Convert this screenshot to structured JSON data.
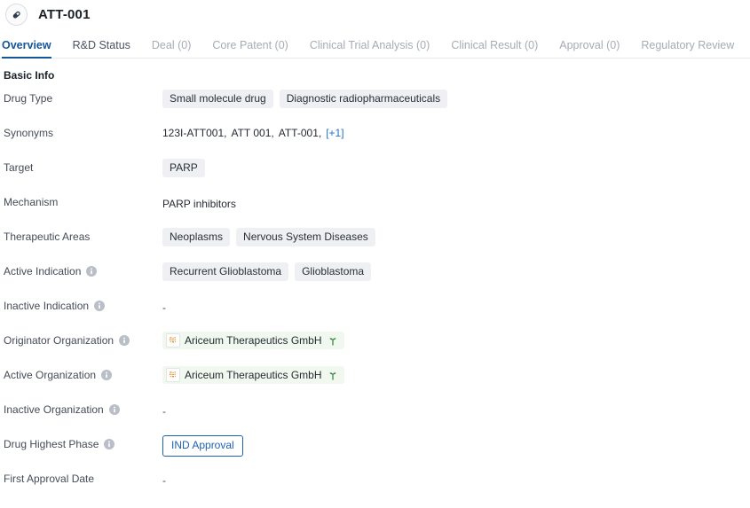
{
  "header": {
    "icon": "pill-capsule-icon",
    "title": "ATT-001"
  },
  "tabs": [
    {
      "label": "Overview",
      "active": true,
      "muted": false
    },
    {
      "label": "R&D Status",
      "active": false,
      "muted": false
    },
    {
      "label": "Deal (0)",
      "active": false,
      "muted": true
    },
    {
      "label": "Core Patent (0)",
      "active": false,
      "muted": true
    },
    {
      "label": "Clinical Trial Analysis (0)",
      "active": false,
      "muted": true
    },
    {
      "label": "Clinical Result (0)",
      "active": false,
      "muted": true
    },
    {
      "label": "Approval (0)",
      "active": false,
      "muted": true
    },
    {
      "label": "Regulatory Review",
      "active": false,
      "muted": true
    }
  ],
  "section": {
    "title": "Basic Info"
  },
  "colors": {
    "accent": "#15559a",
    "link": "#2572c7",
    "chip_bg": "#eff0f3",
    "org_bg": "#f1f8f0",
    "phase_border": "#1e61ad",
    "muted_text": "#a6abb5"
  },
  "rows": {
    "drug_type": {
      "label": "Drug Type",
      "has_info": false,
      "chips": [
        "Small molecule drug",
        "Diagnostic radiopharmaceuticals"
      ]
    },
    "synonyms": {
      "label": "Synonyms",
      "has_info": false,
      "values": [
        "123I-ATT001,",
        "ATT 001,",
        "ATT-001,"
      ],
      "more": "[+1]"
    },
    "target": {
      "label": "Target",
      "has_info": false,
      "chips": [
        "PARP"
      ]
    },
    "mechanism": {
      "label": "Mechanism",
      "has_info": false,
      "text": "PARP inhibitors"
    },
    "therapeutic_areas": {
      "label": "Therapeutic Areas",
      "has_info": false,
      "chips": [
        "Neoplasms",
        "Nervous System Diseases"
      ]
    },
    "active_indication": {
      "label": "Active Indication",
      "has_info": true,
      "chips": [
        "Recurrent Glioblastoma",
        "Glioblastoma"
      ]
    },
    "inactive_indication": {
      "label": "Inactive Indication",
      "has_info": true,
      "text": "-"
    },
    "originator_organization": {
      "label": "Originator Organization",
      "has_info": true,
      "orgs": [
        "Ariceum Therapeutics GmbH"
      ]
    },
    "active_organization": {
      "label": "Active Organization",
      "has_info": true,
      "orgs": [
        "Ariceum Therapeutics GmbH"
      ]
    },
    "inactive_organization": {
      "label": "Inactive Organization",
      "has_info": true,
      "text": "-"
    },
    "drug_highest_phase": {
      "label": "Drug Highest Phase",
      "has_info": true,
      "button": "IND Approval"
    },
    "first_approval_date": {
      "label": "First Approval Date",
      "has_info": false,
      "text": "-"
    }
  },
  "icons": {
    "info": "info-circle-icon",
    "org_logo": "company-logo-icon",
    "sprout": "sprout-icon"
  }
}
